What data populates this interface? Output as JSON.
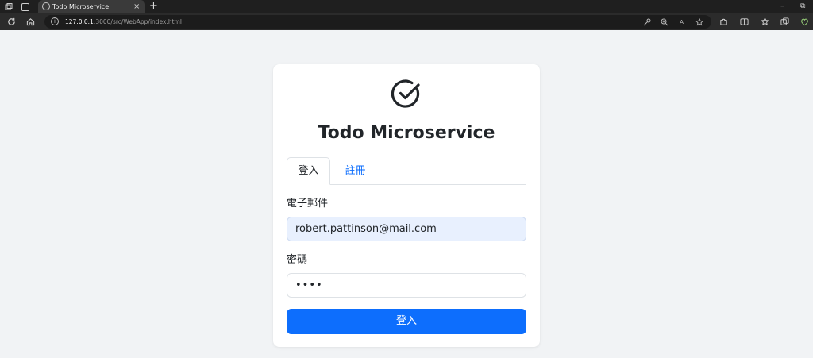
{
  "browser": {
    "tab_title": "Todo Microservice",
    "tab_close": "×",
    "new_tab": "+",
    "url_host": "127.0.0.1",
    "url_path": ":3000/src/WebApp/index.html",
    "minimize": "–",
    "restore": "⧉"
  },
  "app": {
    "title": "Todo Microservice",
    "tabs": [
      {
        "label": "登入",
        "active": true
      },
      {
        "label": "註冊",
        "active": false
      }
    ],
    "email_label": "電子郵件",
    "email_value": "robert.pattinson@mail.com",
    "password_label": "密碼",
    "password_mask": "••••",
    "login_button": "登入"
  },
  "colors": {
    "primary": "#0d6efd",
    "page_bg": "#f1f3f5",
    "autofill_bg": "#e8f0fe"
  },
  "icons": [
    "workspaces-icon",
    "tab-actions-icon",
    "refresh-icon",
    "home-icon",
    "site-info-icon",
    "key-icon",
    "zoom-icon",
    "read-aloud-icon",
    "favorite-icon",
    "extensions-icon",
    "split-screen-icon",
    "favorites-icon",
    "collections-icon",
    "copilot-icon",
    "check-circle-icon"
  ]
}
